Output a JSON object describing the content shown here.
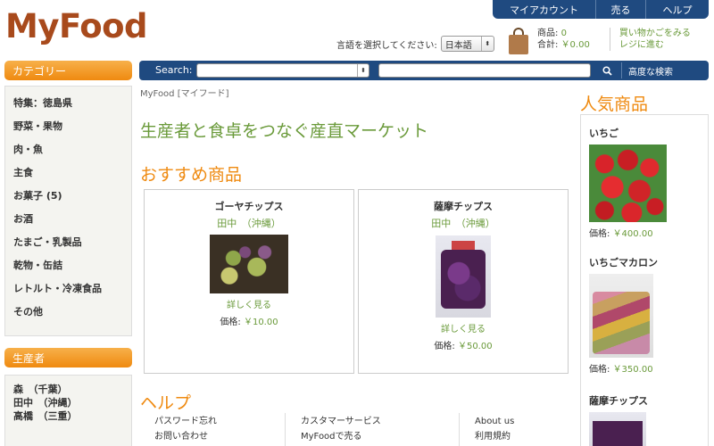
{
  "logo": "MyFood",
  "topnav": [
    "マイアカウント",
    "売る",
    "ヘルプ"
  ],
  "language": {
    "label": "言語を選択してください:",
    "selected": "日本語"
  },
  "cart": {
    "items_label": "商品:",
    "items_value": "0",
    "total_label": "合計:",
    "total_value": "￥0.00",
    "checkout_line1": "買い物かごをみる",
    "checkout_line2": "レジに進む"
  },
  "categories": {
    "title": "カテゴリー",
    "items": [
      "特集：徳島県",
      "野菜・果物",
      "肉・魚",
      "主食",
      "お菓子 (5)",
      "お酒",
      "たまご・乳製品",
      "乾物・缶詰",
      "レトルト・冷凍食品",
      "その他"
    ]
  },
  "producers": {
    "title": "生産者",
    "items": [
      "森　（千葉）",
      "田中　（沖縄）",
      "高橋　（三重）"
    ]
  },
  "search": {
    "label": "Search:",
    "category_value": "",
    "query_value": "",
    "advanced": "高度な検索"
  },
  "breadcrumb": "MyFood [マイフード]",
  "tagline": "生産者と食卓をつなぐ産直マーケット",
  "recommended": {
    "title": "おすすめ商品",
    "items": [
      {
        "name": "ゴーヤチップス",
        "farmer": "田中　（沖縄）",
        "more": "詳しく見る",
        "price_label": "価格:",
        "price": "￥10.00"
      },
      {
        "name": "薩摩チップス",
        "farmer": "田中　（沖縄）",
        "more": "詳しく見る",
        "price_label": "価格:",
        "price": "￥50.00"
      }
    ]
  },
  "help": {
    "title": "ヘルプ",
    "col1": [
      "パスワード忘れ",
      "お問い合わせ"
    ],
    "col2": [
      "カスタマーサービス",
      "MyFoodで売る"
    ],
    "col3": [
      "About us",
      "利用規約"
    ]
  },
  "popular": {
    "title": "人気商品",
    "items": [
      {
        "name": "いちご",
        "price_label": "価格:",
        "price": "￥400.00"
      },
      {
        "name": "いちごマカロン",
        "price_label": "価格:",
        "price": "￥350.00"
      },
      {
        "name": "薩摩チップス"
      }
    ]
  },
  "colors": {
    "nav_blue": "#1f4a80",
    "orange": "#ef8a10",
    "green": "#6a9a3a",
    "logo": "#a84a1c"
  }
}
